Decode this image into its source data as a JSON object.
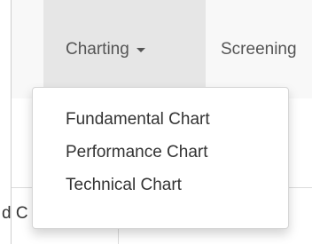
{
  "navbar": {
    "charting_label": "Charting",
    "screening_label": "Screening"
  },
  "dropdown": {
    "items": [
      {
        "label": "Fundamental Chart"
      },
      {
        "label": "Performance Chart"
      },
      {
        "label": "Technical Chart"
      }
    ]
  },
  "table": {
    "partial_cell_text": "d C"
  }
}
